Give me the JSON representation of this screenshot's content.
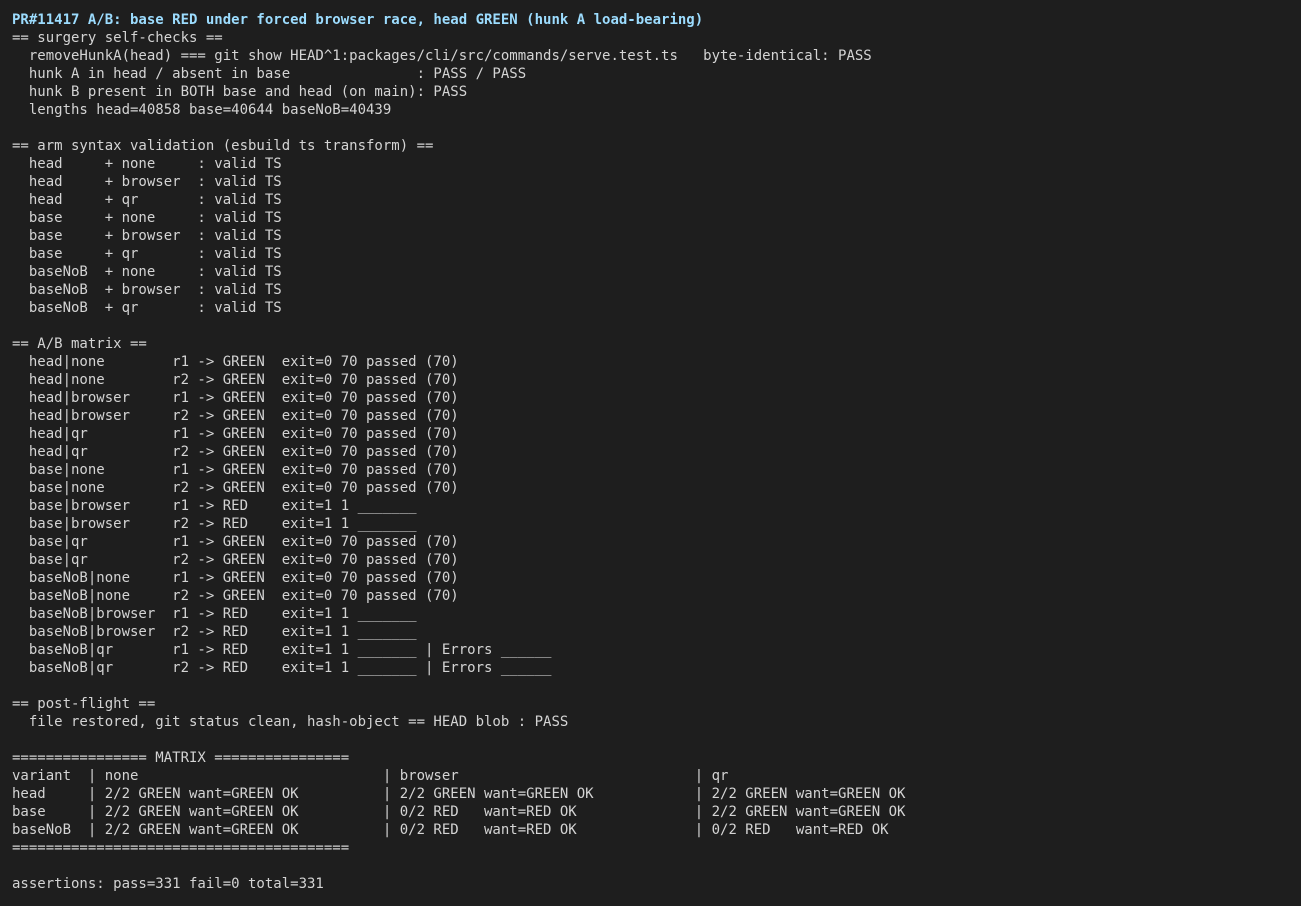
{
  "header": "PR#11417 A/B: base RED under forced browser race, head GREEN (hunk A load-bearing)",
  "surgery": {
    "title": "== surgery self-checks ==",
    "lines": [
      "  removeHunkA(head) === git show HEAD^1:packages/cli/src/commands/serve.test.ts   byte-identical: PASS",
      "  hunk A in head / absent in base               : PASS / PASS",
      "  hunk B present in BOTH base and head (on main): PASS",
      "  lengths head=40858 base=40644 baseNoB=40439"
    ]
  },
  "syntax": {
    "title": "== arm syntax validation (esbuild ts transform) ==",
    "lines": [
      "  head     + none     : valid TS",
      "  head     + browser  : valid TS",
      "  head     + qr       : valid TS",
      "  base     + none     : valid TS",
      "  base     + browser  : valid TS",
      "  base     + qr       : valid TS",
      "  baseNoB  + none     : valid TS",
      "  baseNoB  + browser  : valid TS",
      "  baseNoB  + qr       : valid TS"
    ]
  },
  "ab_matrix": {
    "title": "== A/B matrix ==",
    "lines": [
      "  head|none        r1 -> GREEN  exit=0 70 passed (70)",
      "  head|none        r2 -> GREEN  exit=0 70 passed (70)",
      "  head|browser     r1 -> GREEN  exit=0 70 passed (70)",
      "  head|browser     r2 -> GREEN  exit=0 70 passed (70)",
      "  head|qr          r1 -> GREEN  exit=0 70 passed (70)",
      "  head|qr          r2 -> GREEN  exit=0 70 passed (70)",
      "  base|none        r1 -> GREEN  exit=0 70 passed (70)",
      "  base|none        r2 -> GREEN  exit=0 70 passed (70)",
      "  base|browser     r1 -> RED    exit=1 1 _______",
      "  base|browser     r2 -> RED    exit=1 1 _______",
      "  base|qr          r1 -> GREEN  exit=0 70 passed (70)",
      "  base|qr          r2 -> GREEN  exit=0 70 passed (70)",
      "  baseNoB|none     r1 -> GREEN  exit=0 70 passed (70)",
      "  baseNoB|none     r2 -> GREEN  exit=0 70 passed (70)",
      "  baseNoB|browser  r1 -> RED    exit=1 1 _______",
      "  baseNoB|browser  r2 -> RED    exit=1 1 _______",
      "  baseNoB|qr       r1 -> RED    exit=1 1 _______ | Errors ______",
      "  baseNoB|qr       r2 -> RED    exit=1 1 _______ | Errors ______"
    ]
  },
  "post_flight": {
    "title": "== post-flight ==",
    "lines": [
      "  file restored, git status clean, hash-object == HEAD blob : PASS"
    ]
  },
  "summary": {
    "title": "================ MATRIX ================",
    "lines": [
      "variant  | none                             | browser                            | qr",
      "head     | 2/2 GREEN want=GREEN OK          | 2/2 GREEN want=GREEN OK            | 2/2 GREEN want=GREEN OK",
      "base     | 2/2 GREEN want=GREEN OK          | 0/2 RED   want=RED OK              | 2/2 GREEN want=GREEN OK",
      "baseNoB  | 2/2 GREEN want=GREEN OK          | 0/2 RED   want=RED OK              | 0/2 RED   want=RED OK"
    ],
    "footer": "========================================"
  },
  "assertions": "assertions: pass=331 fail=0 total=331"
}
